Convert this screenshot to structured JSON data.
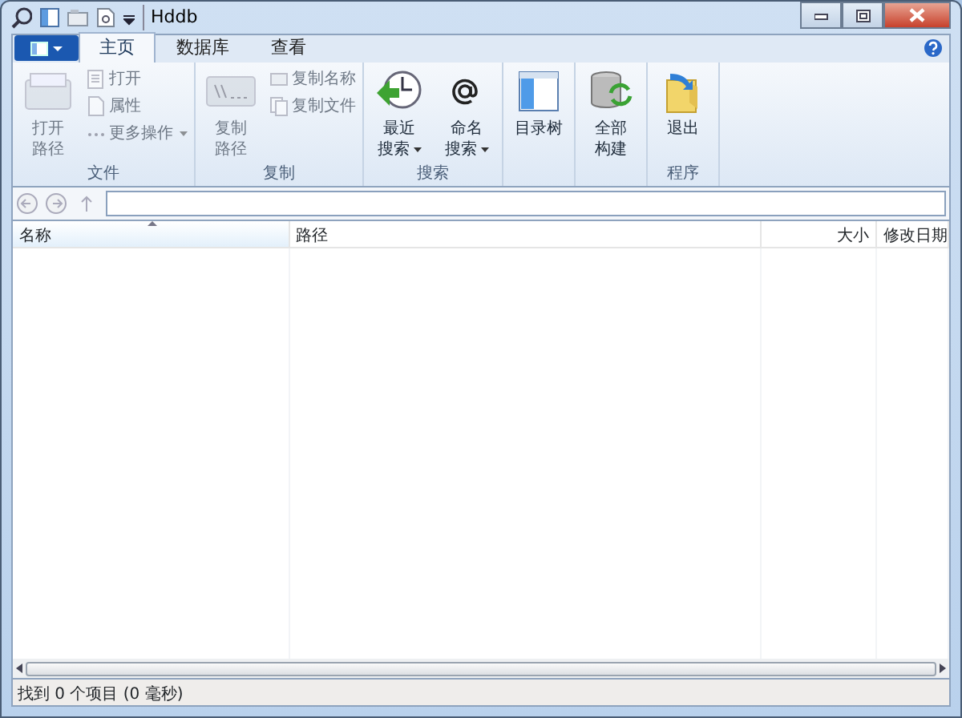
{
  "window": {
    "title": "Hddb"
  },
  "tabs": [
    {
      "label": "主页",
      "selected": true
    },
    {
      "label": "数据库",
      "selected": false
    },
    {
      "label": "查看",
      "selected": false
    }
  ],
  "ribbon": {
    "groups": [
      {
        "label": "文件",
        "disabled": true,
        "items": [
          {
            "kind": "large",
            "lines": [
              "打开",
              "路径"
            ],
            "dropdown": false
          },
          {
            "kind": "small",
            "label": "打开",
            "dropdown": false
          },
          {
            "kind": "small",
            "label": "属性",
            "dropdown": false
          },
          {
            "kind": "small",
            "label": "更多操作",
            "dropdown": true
          }
        ]
      },
      {
        "label": "复制",
        "disabled": true,
        "items": [
          {
            "kind": "large",
            "lines": [
              "复制",
              "路径"
            ],
            "dropdown": false
          },
          {
            "kind": "small",
            "label": "复制名称",
            "dropdown": false
          },
          {
            "kind": "small",
            "label": "复制文件",
            "dropdown": false
          }
        ]
      },
      {
        "label": "搜索",
        "disabled": false,
        "items": [
          {
            "kind": "large",
            "lines": [
              "最近",
              "搜索"
            ],
            "dropdown": true
          },
          {
            "kind": "large",
            "lines": [
              "命名",
              "搜索"
            ],
            "dropdown": true
          }
        ]
      },
      {
        "disabled": false,
        "items": [
          {
            "kind": "large",
            "lines": [
              "目录树"
            ],
            "dropdown": false
          }
        ]
      },
      {
        "disabled": false,
        "items": [
          {
            "kind": "large",
            "lines": [
              "全部",
              "构建"
            ],
            "dropdown": false
          }
        ]
      },
      {
        "label": "程序",
        "disabled": false,
        "items": [
          {
            "kind": "large",
            "lines": [
              "退出"
            ],
            "dropdown": false
          }
        ]
      }
    ]
  },
  "table": {
    "columns": [
      {
        "label": "名称",
        "sorted": true
      },
      {
        "label": "路径",
        "sorted": false
      },
      {
        "label": "大小",
        "sorted": false
      },
      {
        "label": "修改日期",
        "sorted": false
      }
    ]
  },
  "status_bar": "找到 0 个项目 (0 毫秒)"
}
